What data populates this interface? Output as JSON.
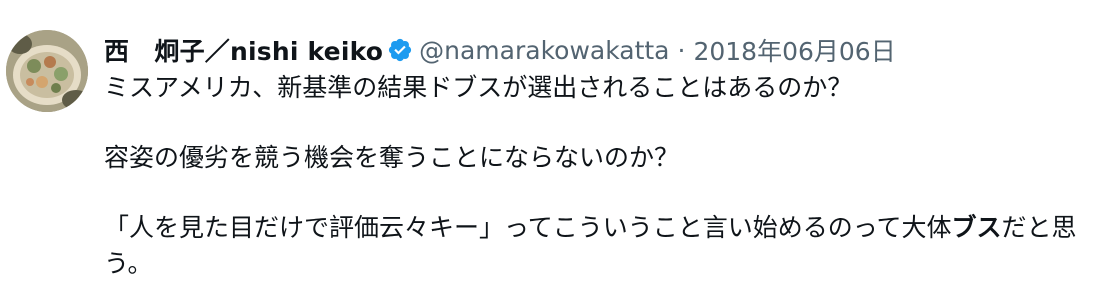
{
  "tweet": {
    "display_name": "西　炯子／nishi keiko",
    "handle": "@namarakowakatta",
    "separator": "·",
    "date": "2018年06月06日",
    "verified_icon": "verified-badge-icon",
    "verified_color": "#1d9bf0",
    "avatar_icon": "avatar-food-photo",
    "body": {
      "line1": "ミスアメリカ、新基準の結果ドブスが選出されることはあるのか？",
      "line2": "容姿の優劣を競う機会を奪うことにならないのか？",
      "line3_a": "「人を見た目だけで評価云々キー」ってこういうこと言い始めるのって大体",
      "line3_bold": "ブス",
      "line3_b": "だと思う。"
    }
  }
}
